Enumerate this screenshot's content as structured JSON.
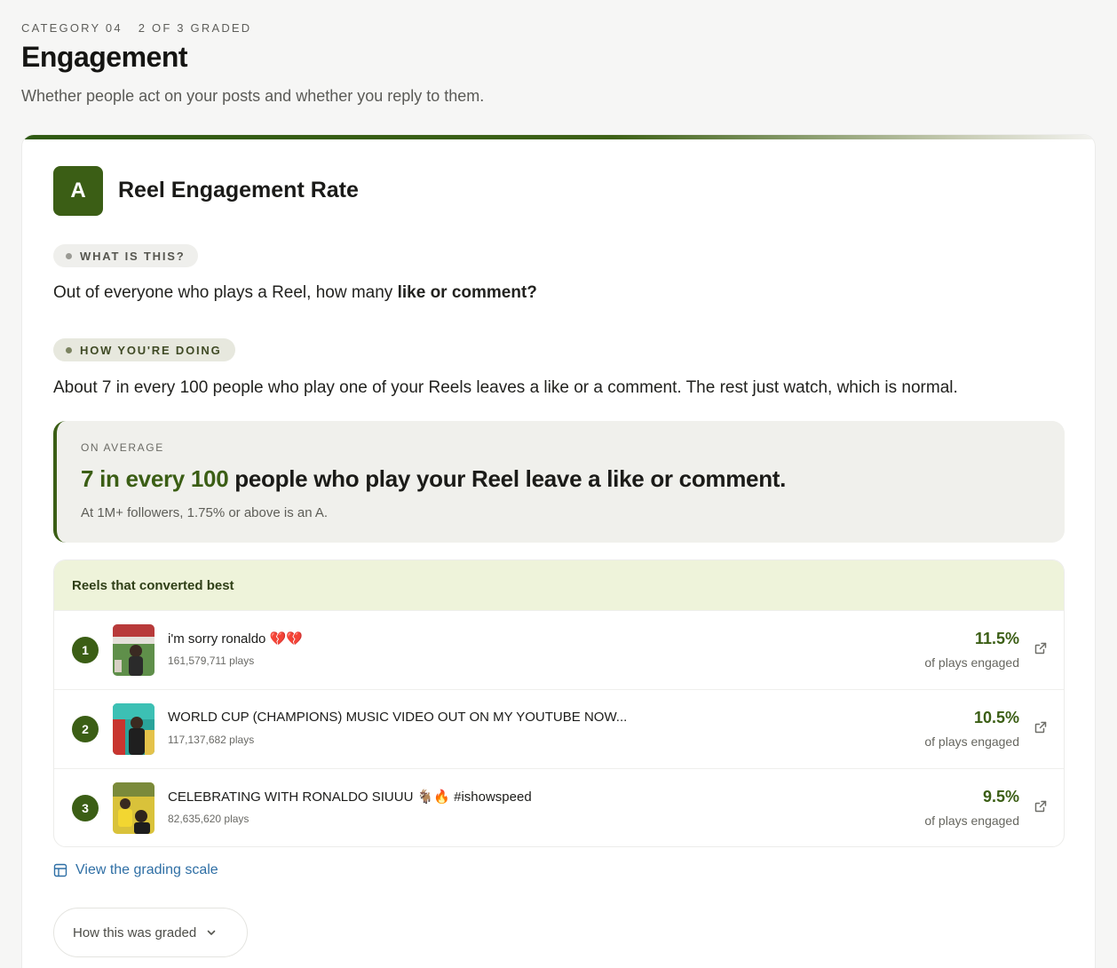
{
  "header": {
    "category": "CATEGORY 04",
    "graded_count": "2 OF 3 GRADED",
    "title": "Engagement",
    "subtitle": "Whether people act on your posts and whether you reply to them."
  },
  "metric": {
    "grade": "A",
    "grade_color": "#3b5e15",
    "title": "Reel Engagement Rate",
    "what_label": "WHAT IS THIS?",
    "what_text_start": "Out of everyone who plays a Reel, how many ",
    "what_text_bold": "like or comment?",
    "how_label": "HOW YOU'RE DOING",
    "how_text": "About 7 in every 100 people who play one of your Reels leaves a like or a comment. The rest just watch, which is normal."
  },
  "average": {
    "label": "ON AVERAGE",
    "highlight": "7 in every 100",
    "rest": " people who play your Reel leave a like or comment.",
    "note": "At 1M+ followers, 1.75% or above is an A."
  },
  "best_reels": {
    "title": "Reels that converted best",
    "rate_label": "of plays engaged",
    "items": [
      {
        "rank": "1",
        "title": "i'm sorry ronaldo 💔💔",
        "plays": "161,579,711 plays",
        "rate": "11.5%"
      },
      {
        "rank": "2",
        "title": "WORLD CUP (CHAMPIONS) MUSIC VIDEO OUT ON MY YOUTUBE NOW...",
        "plays": "117,137,682 plays",
        "rate": "10.5%"
      },
      {
        "rank": "3",
        "title": "CELEBRATING WITH RONALDO SIUUU 🐐🔥 #ishowspeed",
        "plays": "82,635,620 plays",
        "rate": "9.5%"
      }
    ]
  },
  "links": {
    "grading_scale": "View the grading scale",
    "how_graded": "How this was graded"
  },
  "colors": {
    "accent": "#3b5e15",
    "link": "#2f6fa5",
    "best_header_bg": "#eef3da"
  }
}
